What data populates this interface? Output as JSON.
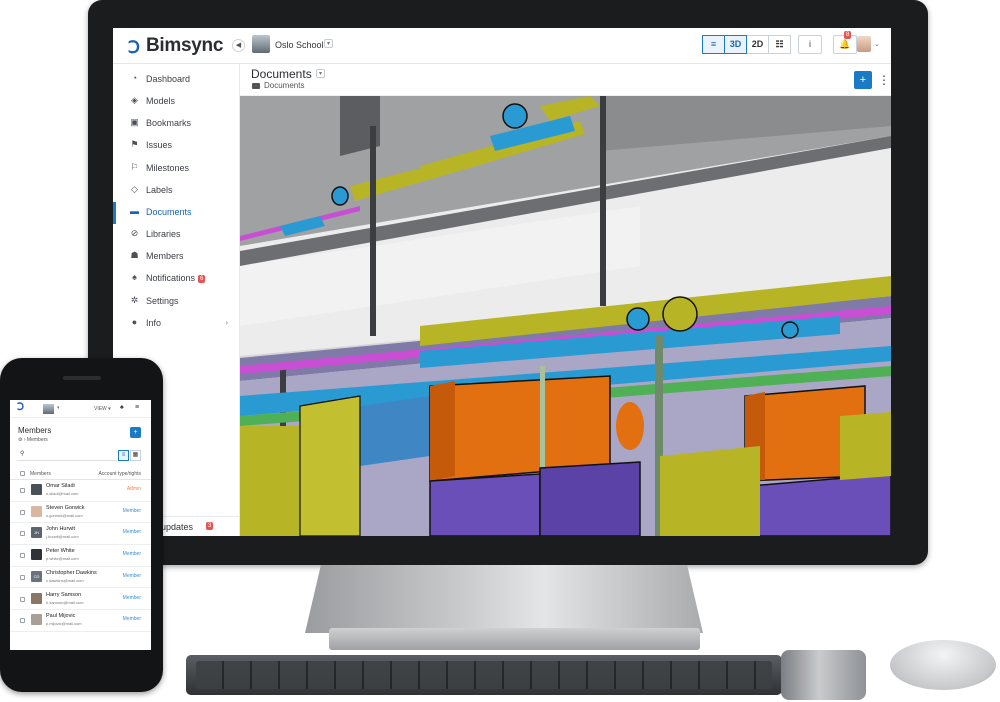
{
  "app": {
    "logo_mark": "Ↄ",
    "name": "Bimsync",
    "project_name": "Oslo School",
    "collapse_icon": "◀",
    "caret": "▾"
  },
  "toolbar": {
    "list_icon": "≡",
    "view_3d": "3D",
    "view_2d": "2D",
    "tree_icon": "☷",
    "info_icon": "i",
    "notification_count": "8",
    "bell_icon": "🔔",
    "user_caret": "⌄"
  },
  "sidebar": {
    "items": [
      {
        "label": "Dashboard",
        "icon": "◔"
      },
      {
        "label": "Models",
        "icon": "◈"
      },
      {
        "label": "Bookmarks",
        "icon": "▣"
      },
      {
        "label": "Issues",
        "icon": "⚑"
      },
      {
        "label": "Milestones",
        "icon": "⚐"
      },
      {
        "label": "Labels",
        "icon": "◇"
      },
      {
        "label": "Documents",
        "icon": "▬"
      },
      {
        "label": "Libraries",
        "icon": "⊘"
      },
      {
        "label": "Members",
        "icon": "☗"
      },
      {
        "label": "Notifications",
        "icon": "♠",
        "badge": "6"
      },
      {
        "label": "Settings",
        "icon": "✲"
      },
      {
        "label": "Info",
        "icon": "●",
        "chevron": "›"
      }
    ],
    "bottom_label": "ent updates",
    "bottom_badge": "3"
  },
  "page": {
    "title": "Documents",
    "breadcrumb": "Documents",
    "add_icon": "+",
    "more_icon": "⋮"
  },
  "phone": {
    "logo_mark": "Ↄ",
    "view_label": "VIEW ▾",
    "bell_icon": "♠",
    "menu_icon": "≡",
    "title": "Members",
    "breadcrumb": "⚙ › Members",
    "add_icon": "+",
    "search_icon": "⚲",
    "list_icon": "≡",
    "grid_icon": "▦",
    "col_members": "Members",
    "col_account": "Account type/rights",
    "members": [
      {
        "name": "Omar Siladi",
        "email": "o.siladi@mail.com",
        "role": "Admin",
        "initials": "",
        "color": "#4a5058"
      },
      {
        "name": "Steven Gorwick",
        "email": "s.gorwick@mail.com",
        "role": "Member",
        "initials": "",
        "color": "#d9b8a3"
      },
      {
        "name": "John Hurwit",
        "email": "j.hurwit@mail.com",
        "role": "Member",
        "initials": "JH",
        "color": "#5d6670"
      },
      {
        "name": "Peter White",
        "email": "p.white@mail.com",
        "role": "Member",
        "initials": "",
        "color": "#2f3339"
      },
      {
        "name": "Christopher Dawkins",
        "email": "c.dawkins@mail.com",
        "role": "Member",
        "initials": "CD",
        "color": "#6a737c"
      },
      {
        "name": "Harry Samson",
        "email": "h.samson@mail.com",
        "role": "Member",
        "initials": "",
        "color": "#8b7565"
      },
      {
        "name": "Paul Mijovic",
        "email": "p.mijovic@mail.com",
        "role": "Member",
        "initials": "",
        "color": "#a79f98"
      }
    ]
  },
  "colors": {
    "accent": "#1a7bc4",
    "brand": "#1a62b3",
    "badge": "#e55353",
    "admin_role": "#f0894a"
  }
}
